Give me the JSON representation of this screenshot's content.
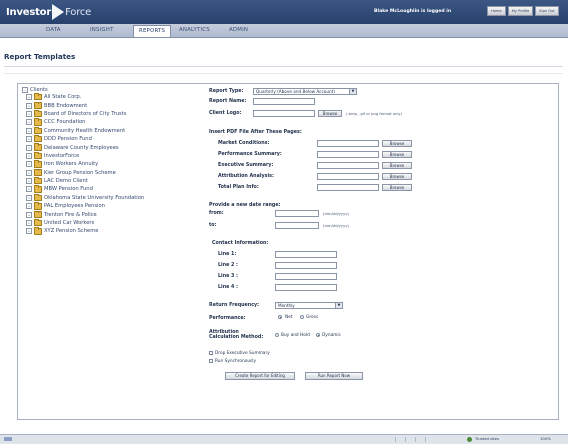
{
  "app": {
    "logo_part1": "Investor",
    "logo_part2": "Force",
    "logged_in_text": "Blake McLoughlin is logged in",
    "header_buttons": [
      "Home",
      "My Profile",
      "Sign Out"
    ]
  },
  "nav": {
    "tabs": [
      "DATA",
      "INSIGHT",
      "REPORTS",
      "ANALYTICS",
      "ADMIN"
    ],
    "active_tab": "REPORTS"
  },
  "page": {
    "title": "Report Templates"
  },
  "tree": {
    "root_label": "Clients",
    "items": [
      "All State Corp.",
      "BBB Endowment",
      "Board of Directors of City Trusts",
      "CCC Foundation",
      "Community Health Endowment",
      "DDD Pension Fund",
      "Delaware County Employees",
      "InvestorForce",
      "Iron Workers Annuity",
      "Kier Group Pension Scheme",
      "LAC Demo Client",
      "MBW Pension Fund",
      "Oklahoma State University Foundation",
      "PAL Employees Pension",
      "Trenton Fire & Police",
      "United Car Workers",
      "XYZ Pension Scheme"
    ]
  },
  "form": {
    "report_type_label": "Report Type:",
    "report_type_value": "Quarterly (Above and Below Account)",
    "report_name_label": "Report Name:",
    "report_name_value": "",
    "client_logo_label": "Client Logo:",
    "client_logo_value": "",
    "browse_label": "Browse",
    "logo_note": "(.bmp, .gif or png format only)",
    "insert_pdf_heading": "Insert PDF File After These Pages:",
    "pdf_pages": [
      {
        "label": "Market Conditions:",
        "value": ""
      },
      {
        "label": "Performance Summary:",
        "value": ""
      },
      {
        "label": "Executive Summary:",
        "value": ""
      },
      {
        "label": "Attribution Analysis:",
        "value": ""
      },
      {
        "label": "Total Plan Info:",
        "value": ""
      }
    ],
    "date_range_heading": "Provide a new date range:",
    "from_label": "from:",
    "from_value": "",
    "to_label": "to:",
    "to_value": "",
    "date_format": "(mm/dd/yyyy)",
    "contact_heading": "Contact Information:",
    "contact_lines": [
      {
        "label": "Line 1:",
        "value": ""
      },
      {
        "label": "Line 2 :",
        "value": ""
      },
      {
        "label": "Line 3 :",
        "value": ""
      },
      {
        "label": "Line 4 :",
        "value": ""
      }
    ],
    "return_frequency_label": "Return Frequency:",
    "return_frequency_value": "Monthly",
    "performance_label": "Performance:",
    "performance_options": [
      "Net",
      "Gross"
    ],
    "performance_selected": "Net",
    "attribution_label_line1": "Attribution",
    "attribution_label_line2": "Calculation Method:",
    "attribution_options": [
      "Buy and Hold",
      "Dynamic"
    ],
    "attribution_selected": "Dynamic",
    "drop_exec_summary_label": "Drop Executive Summary",
    "run_sync_label": "Run Synchronously",
    "create_button": "Create Report for Editing",
    "run_button": "Run Report Now"
  },
  "status_bar": {
    "zone": "Trusted sites",
    "zoom": "100%"
  },
  "colors": {
    "header_bg": "#2f4a78",
    "nav_bg": "#b9c3d7",
    "text": "#1f2f4a",
    "folder": "#e5b94c"
  }
}
